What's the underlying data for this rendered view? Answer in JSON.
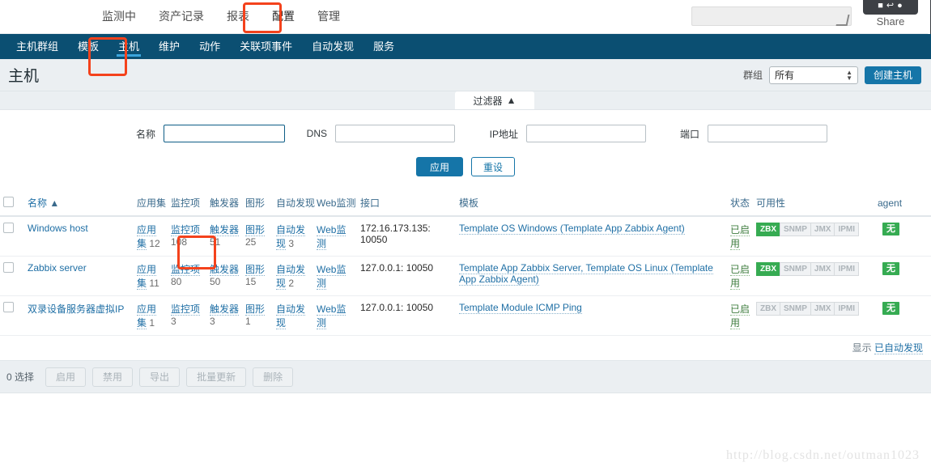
{
  "topnav": {
    "items": [
      {
        "label": "监测中",
        "selected": false
      },
      {
        "label": "资产记录",
        "selected": false
      },
      {
        "label": "报表",
        "selected": false
      },
      {
        "label": "配置",
        "selected": true
      },
      {
        "label": "管理",
        "selected": false
      }
    ],
    "search_placeholder": "",
    "search_value": "",
    "share_label": "Share",
    "share_glyphs": "❚❚"
  },
  "subnav": {
    "items": [
      {
        "label": "主机群组",
        "selected": false
      },
      {
        "label": "模板",
        "selected": false
      },
      {
        "label": "主机",
        "selected": true
      },
      {
        "label": "维护",
        "selected": false
      },
      {
        "label": "动作",
        "selected": false
      },
      {
        "label": "关联项事件",
        "selected": false
      },
      {
        "label": "自动发现",
        "selected": false
      },
      {
        "label": "服务",
        "selected": false
      }
    ]
  },
  "pagehead": {
    "title": "主机",
    "group_label": "群组",
    "group_value": "所有",
    "create_button": "创建主机"
  },
  "filter": {
    "tab_label": "过滤器",
    "tab_arrow": "▲",
    "fields": [
      {
        "label": "名称",
        "value": "",
        "focused": true
      },
      {
        "label": "DNS",
        "value": "",
        "focused": false
      },
      {
        "label": "IP地址",
        "value": "",
        "focused": false
      },
      {
        "label": "端口",
        "value": "",
        "focused": false
      }
    ],
    "apply_label": "应用",
    "reset_label": "重设"
  },
  "table": {
    "headers": {
      "name": "名称",
      "name_sort": "▲",
      "applications": "应用集",
      "items": "监控项",
      "triggers": "触发器",
      "graphs": "图形",
      "discovery": "自动发现",
      "web": "Web监测",
      "interface": "接口",
      "templates": "模板",
      "status": "状态",
      "availability": "可用性",
      "agent": "agent"
    },
    "rows": [
      {
        "name": "Windows host",
        "applications_label": "应用集",
        "applications_count": "12",
        "items_label": "监控项",
        "items_count": "108",
        "triggers_label": "触发器",
        "triggers_count": "51",
        "graphs_label": "图形",
        "graphs_count": "25",
        "discovery_label": "自动发现",
        "discovery_count": "3",
        "web_label": "Web监测",
        "interface": "172.16.173.135: 10050",
        "templates": "Template OS Windows (Template App Zabbix Agent)",
        "status": "已启用",
        "availability": [
          {
            "label": "ZBX",
            "active": true
          },
          {
            "label": "SNMP",
            "active": false
          },
          {
            "label": "JMX",
            "active": false
          },
          {
            "label": "IPMI",
            "active": false
          }
        ],
        "agent_badge": "无"
      },
      {
        "name": "Zabbix server",
        "applications_label": "应用集",
        "applications_count": "11",
        "items_label": "监控项",
        "items_count": "80",
        "triggers_label": "触发器",
        "triggers_count": "50",
        "graphs_label": "图形",
        "graphs_count": "15",
        "discovery_label": "自动发现",
        "discovery_count": "2",
        "web_label": "Web监测",
        "interface": "127.0.0.1: 10050",
        "templates": "Template App Zabbix Server, Template OS Linux (Template App Zabbix Agent)",
        "status": "已启用",
        "availability": [
          {
            "label": "ZBX",
            "active": true
          },
          {
            "label": "SNMP",
            "active": false
          },
          {
            "label": "JMX",
            "active": false
          },
          {
            "label": "IPMI",
            "active": false
          }
        ],
        "agent_badge": "无"
      },
      {
        "name": "双录设备服务器虚拟IP",
        "applications_label": "应用集",
        "applications_count": "1",
        "items_label": "监控项",
        "items_count": "3",
        "triggers_label": "触发器",
        "triggers_count": "3",
        "graphs_label": "图形",
        "graphs_count": "1",
        "discovery_label": "自动发现",
        "discovery_count": "",
        "web_label": "Web监测",
        "interface": "127.0.0.1: 10050",
        "templates": "Template Module ICMP Ping",
        "status": "已启用",
        "availability": [
          {
            "label": "ZBX",
            "active": false
          },
          {
            "label": "SNMP",
            "active": false
          },
          {
            "label": "JMX",
            "active": false
          },
          {
            "label": "IPMI",
            "active": false
          }
        ],
        "agent_badge": "无"
      }
    ],
    "footnote_prefix": "显示",
    "footnote_link": "已自动发现"
  },
  "bulkbar": {
    "selection_text": "0 选择",
    "buttons": [
      "启用",
      "禁用",
      "导出",
      "批量更新",
      "删除"
    ]
  },
  "watermark": "http://blog.csdn.net/outman1023",
  "colors": {
    "nav_blue": "#0b4f72",
    "accent_blue": "#1575a8",
    "annotation_red": "#f4421c",
    "status_green": "#36ab52"
  }
}
